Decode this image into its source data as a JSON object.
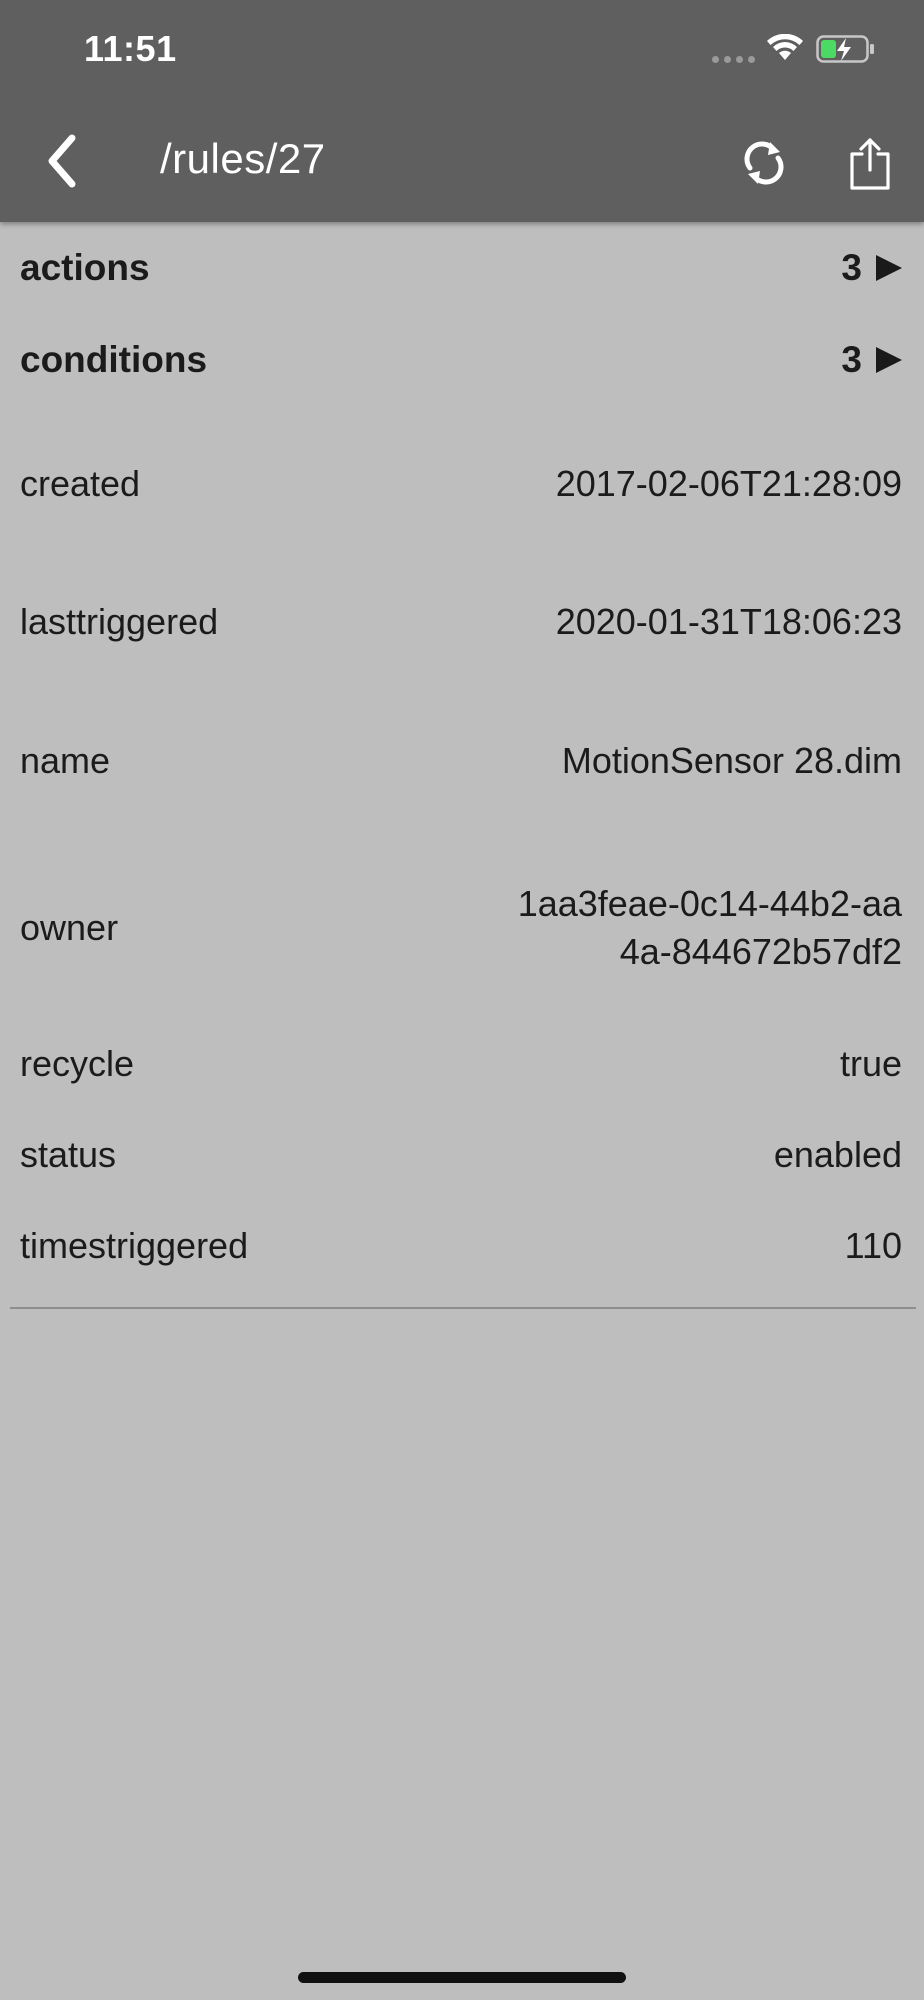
{
  "status_bar": {
    "time": "11:51",
    "icons": [
      "cellular-signal-icon",
      "wifi-icon",
      "battery-charging-icon"
    ],
    "battery_color": "#4cd964"
  },
  "nav_bar": {
    "title": "/rules/27",
    "back_icon": "chevron-left-icon",
    "refresh_icon": "refresh-icon",
    "share_icon": "share-icon"
  },
  "rows": [
    {
      "key": "actions",
      "value": "3",
      "expandable": true
    },
    {
      "key": "conditions",
      "value": "3",
      "expandable": true
    },
    {
      "key": "created",
      "value": "2017-02-06T21:28:09",
      "expandable": false
    },
    {
      "key": "lasttriggered",
      "value": "2020-01-31T18:06:23",
      "expandable": false
    },
    {
      "key": "name",
      "value": "MotionSensor 28.dim",
      "expandable": false
    },
    {
      "key": "owner",
      "value": "1aa3feae-0c14-44b2-aa4a-844672b57df2",
      "expandable": false
    },
    {
      "key": "recycle",
      "value": "true",
      "expandable": false
    },
    {
      "key": "status",
      "value": "enabled",
      "expandable": false
    },
    {
      "key": "timestriggered",
      "value": "110",
      "expandable": false
    }
  ],
  "colors": {
    "topbar": "#5f5f5f",
    "background": "#bebebe",
    "text": "#1b1b1b"
  }
}
